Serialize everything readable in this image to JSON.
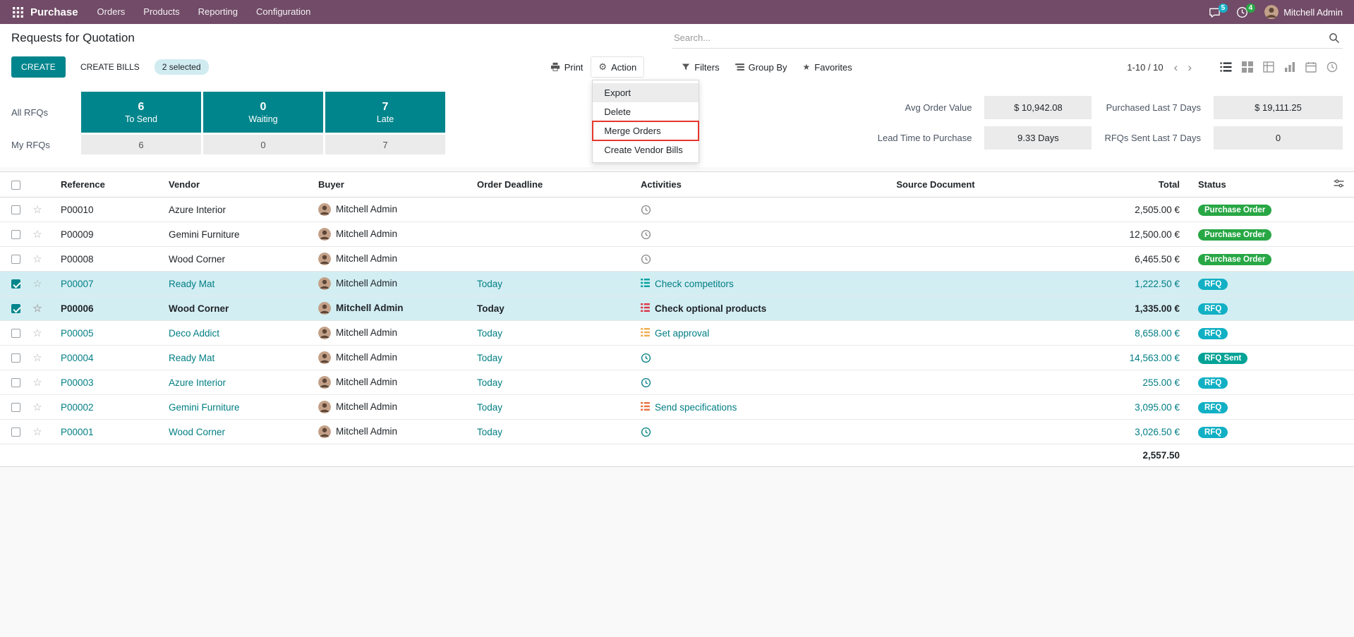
{
  "colors": {
    "topbar_bg": "#714B67",
    "accent": "#01858c",
    "link": "#017e84",
    "badge_success": "#28a745",
    "badge_info": "#12b0c4",
    "badge_rfq_sent": "#02a396",
    "selected_row_bg": "#d2eef3",
    "selection_pill_bg": "#d1ecf1",
    "annotation_red": "#e5372c",
    "messages_badge_bg": "#17b0c8",
    "activities_badge_bg": "#28a745"
  },
  "topbar": {
    "app_name": "Purchase",
    "menus": [
      "Orders",
      "Products",
      "Reporting",
      "Configuration"
    ],
    "messages_badge": "5",
    "activities_badge": "4",
    "user_name": "Mitchell Admin"
  },
  "breadcrumb": {
    "title": "Requests for Quotation"
  },
  "search": {
    "placeholder": "Search..."
  },
  "controls": {
    "create_label": "CREATE",
    "create_bills_label": "CREATE BILLS",
    "selected_label": "2 selected",
    "print_label": "Print",
    "action_label": "Action",
    "filters_label": "Filters",
    "group_by_label": "Group By",
    "favorites_label": "Favorites",
    "pager": "1-10 / 10"
  },
  "action_menu": {
    "items": [
      {
        "label": "Export",
        "hovered": true,
        "outlined": false
      },
      {
        "label": "Delete",
        "hovered": false,
        "outlined": false
      },
      {
        "label": "Merge Orders",
        "hovered": false,
        "outlined": true
      },
      {
        "label": "Create Vendor Bills",
        "hovered": false,
        "outlined": false
      }
    ]
  },
  "dashboard": {
    "rows": [
      "All RFQs",
      "My RFQs"
    ],
    "stats": [
      {
        "label": "To Send",
        "all": "6",
        "my": "6"
      },
      {
        "label": "Waiting",
        "all": "0",
        "my": "0"
      },
      {
        "label": "Late",
        "all": "7",
        "my": "7"
      }
    ],
    "kpis": [
      {
        "label": "Avg Order Value",
        "value": "$ 10,942.08"
      },
      {
        "label": "Purchased Last 7 Days",
        "value": "$ 19,111.25"
      },
      {
        "label": "Lead Time to Purchase",
        "value": "9.33 Days"
      },
      {
        "label": "RFQs Sent Last 7 Days",
        "value": "0"
      }
    ]
  },
  "table": {
    "headers": [
      "Reference",
      "Vendor",
      "Buyer",
      "Order Deadline",
      "Activities",
      "Source Document",
      "Total",
      "Status"
    ],
    "rows": [
      {
        "reference": "P00010",
        "vendor": "Azure Interior",
        "buyer": "Mitchell Admin",
        "deadline": "",
        "activity_label": "",
        "activity_color": "",
        "source": "",
        "total": "2,505.00 €",
        "status": "Purchase Order",
        "status_type": "success",
        "selected": false,
        "style": "dark",
        "bold": false
      },
      {
        "reference": "P00009",
        "vendor": "Gemini Furniture",
        "buyer": "Mitchell Admin",
        "deadline": "",
        "activity_label": "",
        "activity_color": "",
        "source": "",
        "total": "12,500.00 €",
        "status": "Purchase Order",
        "status_type": "success",
        "selected": false,
        "style": "dark",
        "bold": false
      },
      {
        "reference": "P00008",
        "vendor": "Wood Corner",
        "buyer": "Mitchell Admin",
        "deadline": "",
        "activity_label": "",
        "activity_color": "",
        "source": "",
        "total": "6,465.50 €",
        "status": "Purchase Order",
        "status_type": "success",
        "selected": false,
        "style": "dark",
        "bold": false
      },
      {
        "reference": "P00007",
        "vendor": "Ready Mat",
        "buyer": "Mitchell Admin",
        "deadline": "Today",
        "activity_label": "Check competitors",
        "activity_color": "#00a09d",
        "source": "",
        "total": "1,222.50 €",
        "status": "RFQ",
        "status_type": "info",
        "selected": true,
        "style": "info",
        "bold": false
      },
      {
        "reference": "P00006",
        "vendor": "Wood Corner",
        "buyer": "Mitchell Admin",
        "deadline": "Today",
        "activity_label": "Check optional products",
        "activity_color": "#dc3545",
        "source": "",
        "total": "1,335.00 €",
        "status": "RFQ",
        "status_type": "info",
        "selected": true,
        "style": "dark",
        "bold": true
      },
      {
        "reference": "P00005",
        "vendor": "Deco Addict",
        "buyer": "Mitchell Admin",
        "deadline": "Today",
        "activity_label": "Get approval",
        "activity_color": "#f0ad4e",
        "source": "",
        "total": "8,658.00 €",
        "status": "RFQ",
        "status_type": "info",
        "selected": false,
        "style": "info",
        "bold": false
      },
      {
        "reference": "P00004",
        "vendor": "Ready Mat",
        "buyer": "Mitchell Admin",
        "deadline": "Today",
        "activity_label": "",
        "activity_color": "",
        "source": "",
        "total": "14,563.00 €",
        "status": "RFQ Sent",
        "status_type": "sent",
        "selected": false,
        "style": "info",
        "bold": false
      },
      {
        "reference": "P00003",
        "vendor": "Azure Interior",
        "buyer": "Mitchell Admin",
        "deadline": "Today",
        "activity_label": "",
        "activity_color": "",
        "source": "",
        "total": "255.00 €",
        "status": "RFQ",
        "status_type": "info",
        "selected": false,
        "style": "info",
        "bold": false
      },
      {
        "reference": "P00002",
        "vendor": "Gemini Furniture",
        "buyer": "Mitchell Admin",
        "deadline": "Today",
        "activity_label": "Send specifications",
        "activity_color": "#ea6f3b",
        "source": "",
        "total": "3,095.00 €",
        "status": "RFQ",
        "status_type": "info",
        "selected": false,
        "style": "info",
        "bold": false
      },
      {
        "reference": "P00001",
        "vendor": "Wood Corner",
        "buyer": "Mitchell Admin",
        "deadline": "Today",
        "activity_label": "",
        "activity_color": "",
        "source": "",
        "total": "3,026.50 €",
        "status": "RFQ",
        "status_type": "info",
        "selected": false,
        "style": "info",
        "bold": false
      }
    ],
    "footer_total": "2,557.50"
  }
}
